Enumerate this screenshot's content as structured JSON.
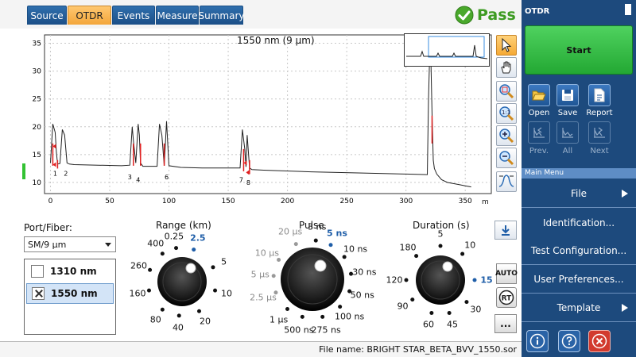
{
  "tabs": [
    {
      "label": "Source",
      "active": false
    },
    {
      "label": "OTDR",
      "active": true
    },
    {
      "label": "Events",
      "active": false
    },
    {
      "label": "Measure",
      "active": false
    },
    {
      "label": "Summary",
      "active": false
    }
  ],
  "status": {
    "label": "Pass",
    "color": "#3d9b22"
  },
  "graph": {
    "title": "1550 nm (9 µm)",
    "x_unit": "m",
    "x_ticks": [
      "0",
      "50",
      "100",
      "150",
      "200",
      "250",
      "300",
      "350"
    ],
    "y_ticks": [
      "10",
      "15",
      "20",
      "25",
      "30",
      "35"
    ],
    "event_markers": [
      "1",
      "2",
      "3",
      "4",
      "6",
      "7",
      "8"
    ]
  },
  "chart_data": {
    "type": "line",
    "x_unit": "m",
    "xlim": [
      -5,
      372
    ],
    "ylim": [
      8,
      36.5
    ],
    "x": [
      0,
      2,
      4,
      5,
      6,
      8,
      10,
      12,
      14,
      16,
      20,
      40,
      60,
      67,
      69,
      70,
      72,
      74,
      75,
      76,
      78,
      80,
      90,
      92,
      94,
      96,
      98,
      100,
      110,
      128,
      160,
      162,
      164,
      165,
      166,
      168,
      170,
      180,
      220,
      260,
      300,
      318,
      319,
      320,
      321,
      322,
      323,
      324,
      326,
      330,
      335,
      340,
      345,
      350,
      355
    ],
    "y": [
      13.5,
      20.5,
      19,
      15.5,
      13.3,
      13.4,
      19.5,
      18.5,
      13.5,
      13.3,
      13.2,
      13.1,
      13.0,
      13.1,
      20.0,
      17.5,
      13.5,
      20.5,
      18.5,
      13.5,
      12.9,
      12.9,
      12.9,
      20.5,
      18.5,
      13.0,
      21.0,
      13.0,
      12.7,
      12.6,
      12.6,
      19.5,
      16.0,
      12.8,
      18.5,
      12.6,
      12.3,
      12.2,
      11.9,
      11.7,
      11.5,
      11.4,
      25.0,
      33.0,
      32.0,
      22.0,
      14.0,
      12.5,
      11.5,
      10.5,
      10.0,
      9.8,
      9.6,
      9.4,
      9.2
    ],
    "series": [
      {
        "name": "1550 nm (9 µm)"
      }
    ]
  },
  "graph_tools": [
    "pointer-icon",
    "hand-pan-icon",
    "zoom-area-icon",
    "zoom-reset-icon",
    "zoom-in-icon",
    "zoom-out-icon",
    "fit-trace-icon"
  ],
  "port_fiber": {
    "label": "Port/Fiber:",
    "value": "SM/9 µm"
  },
  "wavelengths": [
    {
      "label": "1310 nm",
      "checked": false
    },
    {
      "label": "1550 nm",
      "checked": true
    }
  ],
  "range_dial": {
    "title": "Range (km)",
    "selected": "2.5",
    "labels": [
      "0.25",
      "2.5",
      "5",
      "10",
      "20",
      "40",
      "80",
      "160",
      "260",
      "400"
    ]
  },
  "pulse_dial": {
    "title": "Pulse",
    "selected": "5 ns",
    "labels": [
      "3 ns",
      "5 ns",
      "10 ns",
      "30 ns",
      "50 ns",
      "100 ns",
      "275 ns",
      "500 ns",
      "1 µs",
      "2.5 µs",
      "5 µs",
      "10 µs",
      "20 µs"
    ],
    "disabled": [
      "2.5 µs",
      "5 µs",
      "10 µs",
      "20 µs"
    ]
  },
  "duration_dial": {
    "title": "Duration (s)",
    "selected": "15",
    "labels": [
      "5",
      "10",
      "15",
      "30",
      "45",
      "60",
      "90",
      "120",
      "180"
    ]
  },
  "side_tools": {
    "auto": "AUTO",
    "rt": "RT",
    "more": "..."
  },
  "file": {
    "label": "File name: BRIGHT STAR_BETA_BVV_1550.sor"
  },
  "panel": {
    "title": "OTDR",
    "start": "Start",
    "buttons": [
      {
        "label": "Open",
        "icon": "folder-open-icon"
      },
      {
        "label": "Save",
        "icon": "save-disk-icon"
      },
      {
        "label": "Report",
        "icon": "report-document-icon"
      }
    ],
    "nav": [
      {
        "label": "Prev.",
        "icon": "previous-trace-icon"
      },
      {
        "label": "All",
        "icon": "all-traces-icon"
      },
      {
        "label": "Next",
        "icon": "next-trace-icon"
      }
    ],
    "main_menu_label": "Main Menu",
    "menu": [
      {
        "label": "File",
        "arrow": true
      },
      {
        "label": "Identification...",
        "arrow": false
      },
      {
        "label": "Test Configuration...",
        "arrow": false
      },
      {
        "label": "User Preferences...",
        "arrow": false
      },
      {
        "label": "Template",
        "arrow": true
      }
    ],
    "bottom_buttons": [
      "info-icon",
      "help-icon",
      "close-icon"
    ]
  },
  "colors": {
    "accent_orange": "#f3a63b",
    "panel_blue": "#1d4a7d",
    "start_green": "#23a833",
    "selected_blue": "#1f5ea8"
  }
}
